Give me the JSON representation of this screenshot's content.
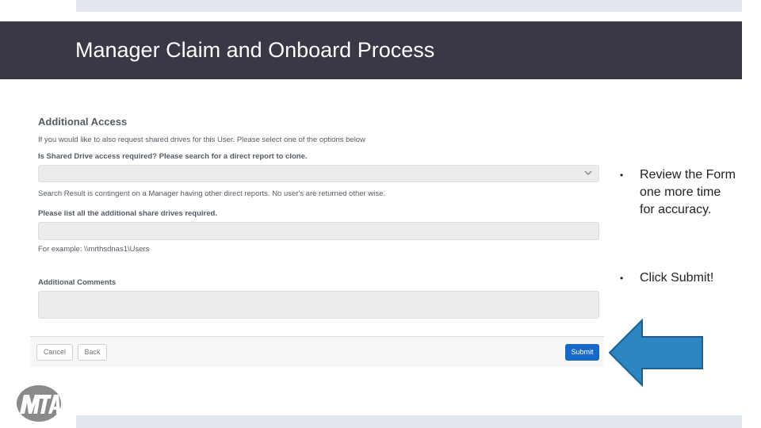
{
  "slide": {
    "title": "Manager Claim and Onboard Process"
  },
  "form": {
    "section_heading": "Additional Access",
    "intro_text": "If you would like to also request shared drives for this User. Please select one of the options below",
    "shared_drive_question": "Is Shared Drive access required? Please search for a direct report to clone.",
    "search_select_value": "",
    "contingent_note": "Search Result is contingent on a Manager having other direct reports. No user's are returned other wise.",
    "share_drives_label": "Please list all the additional share drives required.",
    "share_drives_value": "",
    "example_text": "For example: \\\\mrthsdnas1\\Users",
    "comments_label": "Additional Comments",
    "comments_value": "",
    "buttons": {
      "cancel": "Cancel",
      "back": "Back",
      "submit": "Submit"
    }
  },
  "bullets": [
    "Review the Form one more time for accuracy.",
    "Click Submit!"
  ],
  "bullet_marker": "•",
  "logo": {
    "text": "MTA",
    "icon": "mta-logo"
  },
  "arrow": {
    "icon": "arrow-left-icon",
    "color": "#2e86c1"
  },
  "colors": {
    "header_band": "#383944",
    "submit_button": "#1769c9"
  }
}
